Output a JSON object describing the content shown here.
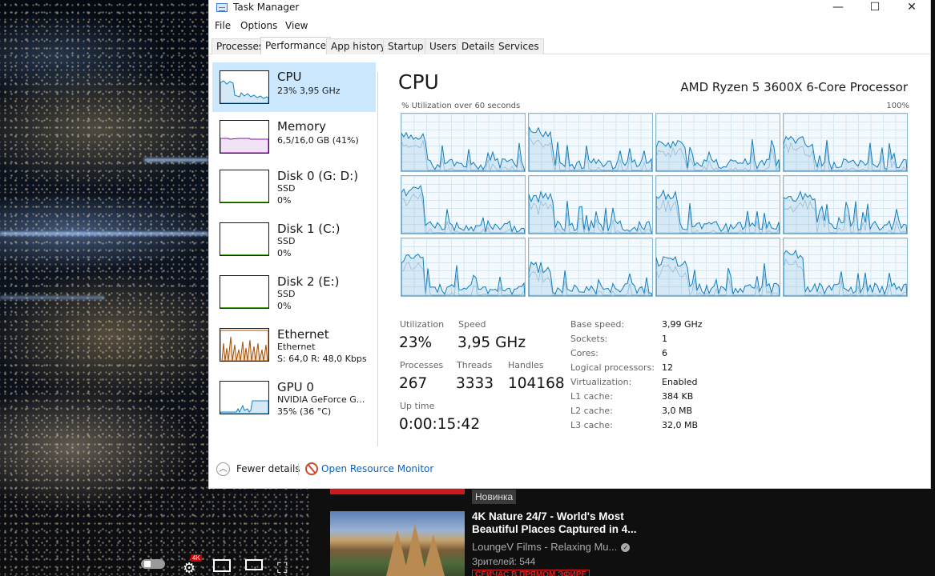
{
  "window": {
    "title": "Task Manager",
    "minimize": "—",
    "maximize": "☐",
    "close": "✕"
  },
  "menu": [
    "File",
    "Options",
    "View"
  ],
  "tabs": [
    "Processes",
    "Performance",
    "App history",
    "Startup",
    "Users",
    "Details",
    "Services"
  ],
  "active_tab": "Performance",
  "sidebar": [
    {
      "name": "CPU",
      "sub1": "23% 3,95 GHz",
      "sub2": "",
      "sub3": "",
      "color": "#1182c3",
      "icon": "cpu-graph"
    },
    {
      "name": "Memory",
      "sub1": "6,5/16,0 GB (41%)",
      "sub2": "",
      "sub3": "",
      "color": "#8b12ae",
      "icon": "memory-graph"
    },
    {
      "name": "Disk 0 (G: D:)",
      "sub1": "SSD",
      "sub2": "0%",
      "sub3": "",
      "color": "#4da60c",
      "icon": "disk-graph"
    },
    {
      "name": "Disk 1 (C:)",
      "sub1": "SSD",
      "sub2": "0%",
      "sub3": "",
      "color": "#4da60c",
      "icon": "disk-graph"
    },
    {
      "name": "Disk 2 (E:)",
      "sub1": "SSD",
      "sub2": "0%",
      "sub3": "",
      "color": "#4da60c",
      "icon": "disk-graph"
    },
    {
      "name": "Ethernet",
      "sub1": "Ethernet",
      "sub2": "S: 64,0 R: 48,0 Kbps",
      "sub3": "",
      "color": "#a74f01",
      "icon": "ethernet-graph"
    },
    {
      "name": "GPU 0",
      "sub1": "NVIDIA GeForce G...",
      "sub2": "35% (36 °C)",
      "sub3": "",
      "color": "#1182c3",
      "icon": "gpu-graph"
    }
  ],
  "main": {
    "title": "CPU",
    "processor": "AMD Ryzen 5 3600X 6-Core Processor",
    "caption_left": "% Utilization over 60 seconds",
    "caption_right": "100%",
    "graph_color": "#117dbb",
    "stats": {
      "utilization_label": "Utilization",
      "utilization": "23%",
      "speed_label": "Speed",
      "speed": "3,95 GHz",
      "processes_label": "Processes",
      "processes": "267",
      "threads_label": "Threads",
      "threads": "3333",
      "handles_label": "Handles",
      "handles": "104168",
      "uptime_label": "Up time",
      "uptime": "0:00:15:42"
    },
    "details": [
      {
        "label": "Base speed:",
        "value": "3,99 GHz"
      },
      {
        "label": "Sockets:",
        "value": "1"
      },
      {
        "label": "Cores:",
        "value": "6"
      },
      {
        "label": "Logical processors:",
        "value": "12"
      },
      {
        "label": "Virtualization:",
        "value": "Enabled"
      },
      {
        "label": "L1 cache:",
        "value": "384 KB"
      },
      {
        "label": "L2 cache:",
        "value": "3,0 MB"
      },
      {
        "label": "L3 cache:",
        "value": "32,0 MB"
      }
    ]
  },
  "footer": {
    "fewer_details": "Fewer details",
    "resource_monitor": "Open Resource Monitor"
  },
  "youtube": {
    "badge": "Новинка",
    "video_title": "4K Nature 24/7 - World's Most Beautiful Places Captured in 4...",
    "channel": "LoungeV Films - Relaxing Mu...",
    "viewers": "Зрителей: 544",
    "live": "СЕЙЧАС В ПРЯМОМ ЭФИРЕ",
    "quality_badge": "4K"
  }
}
